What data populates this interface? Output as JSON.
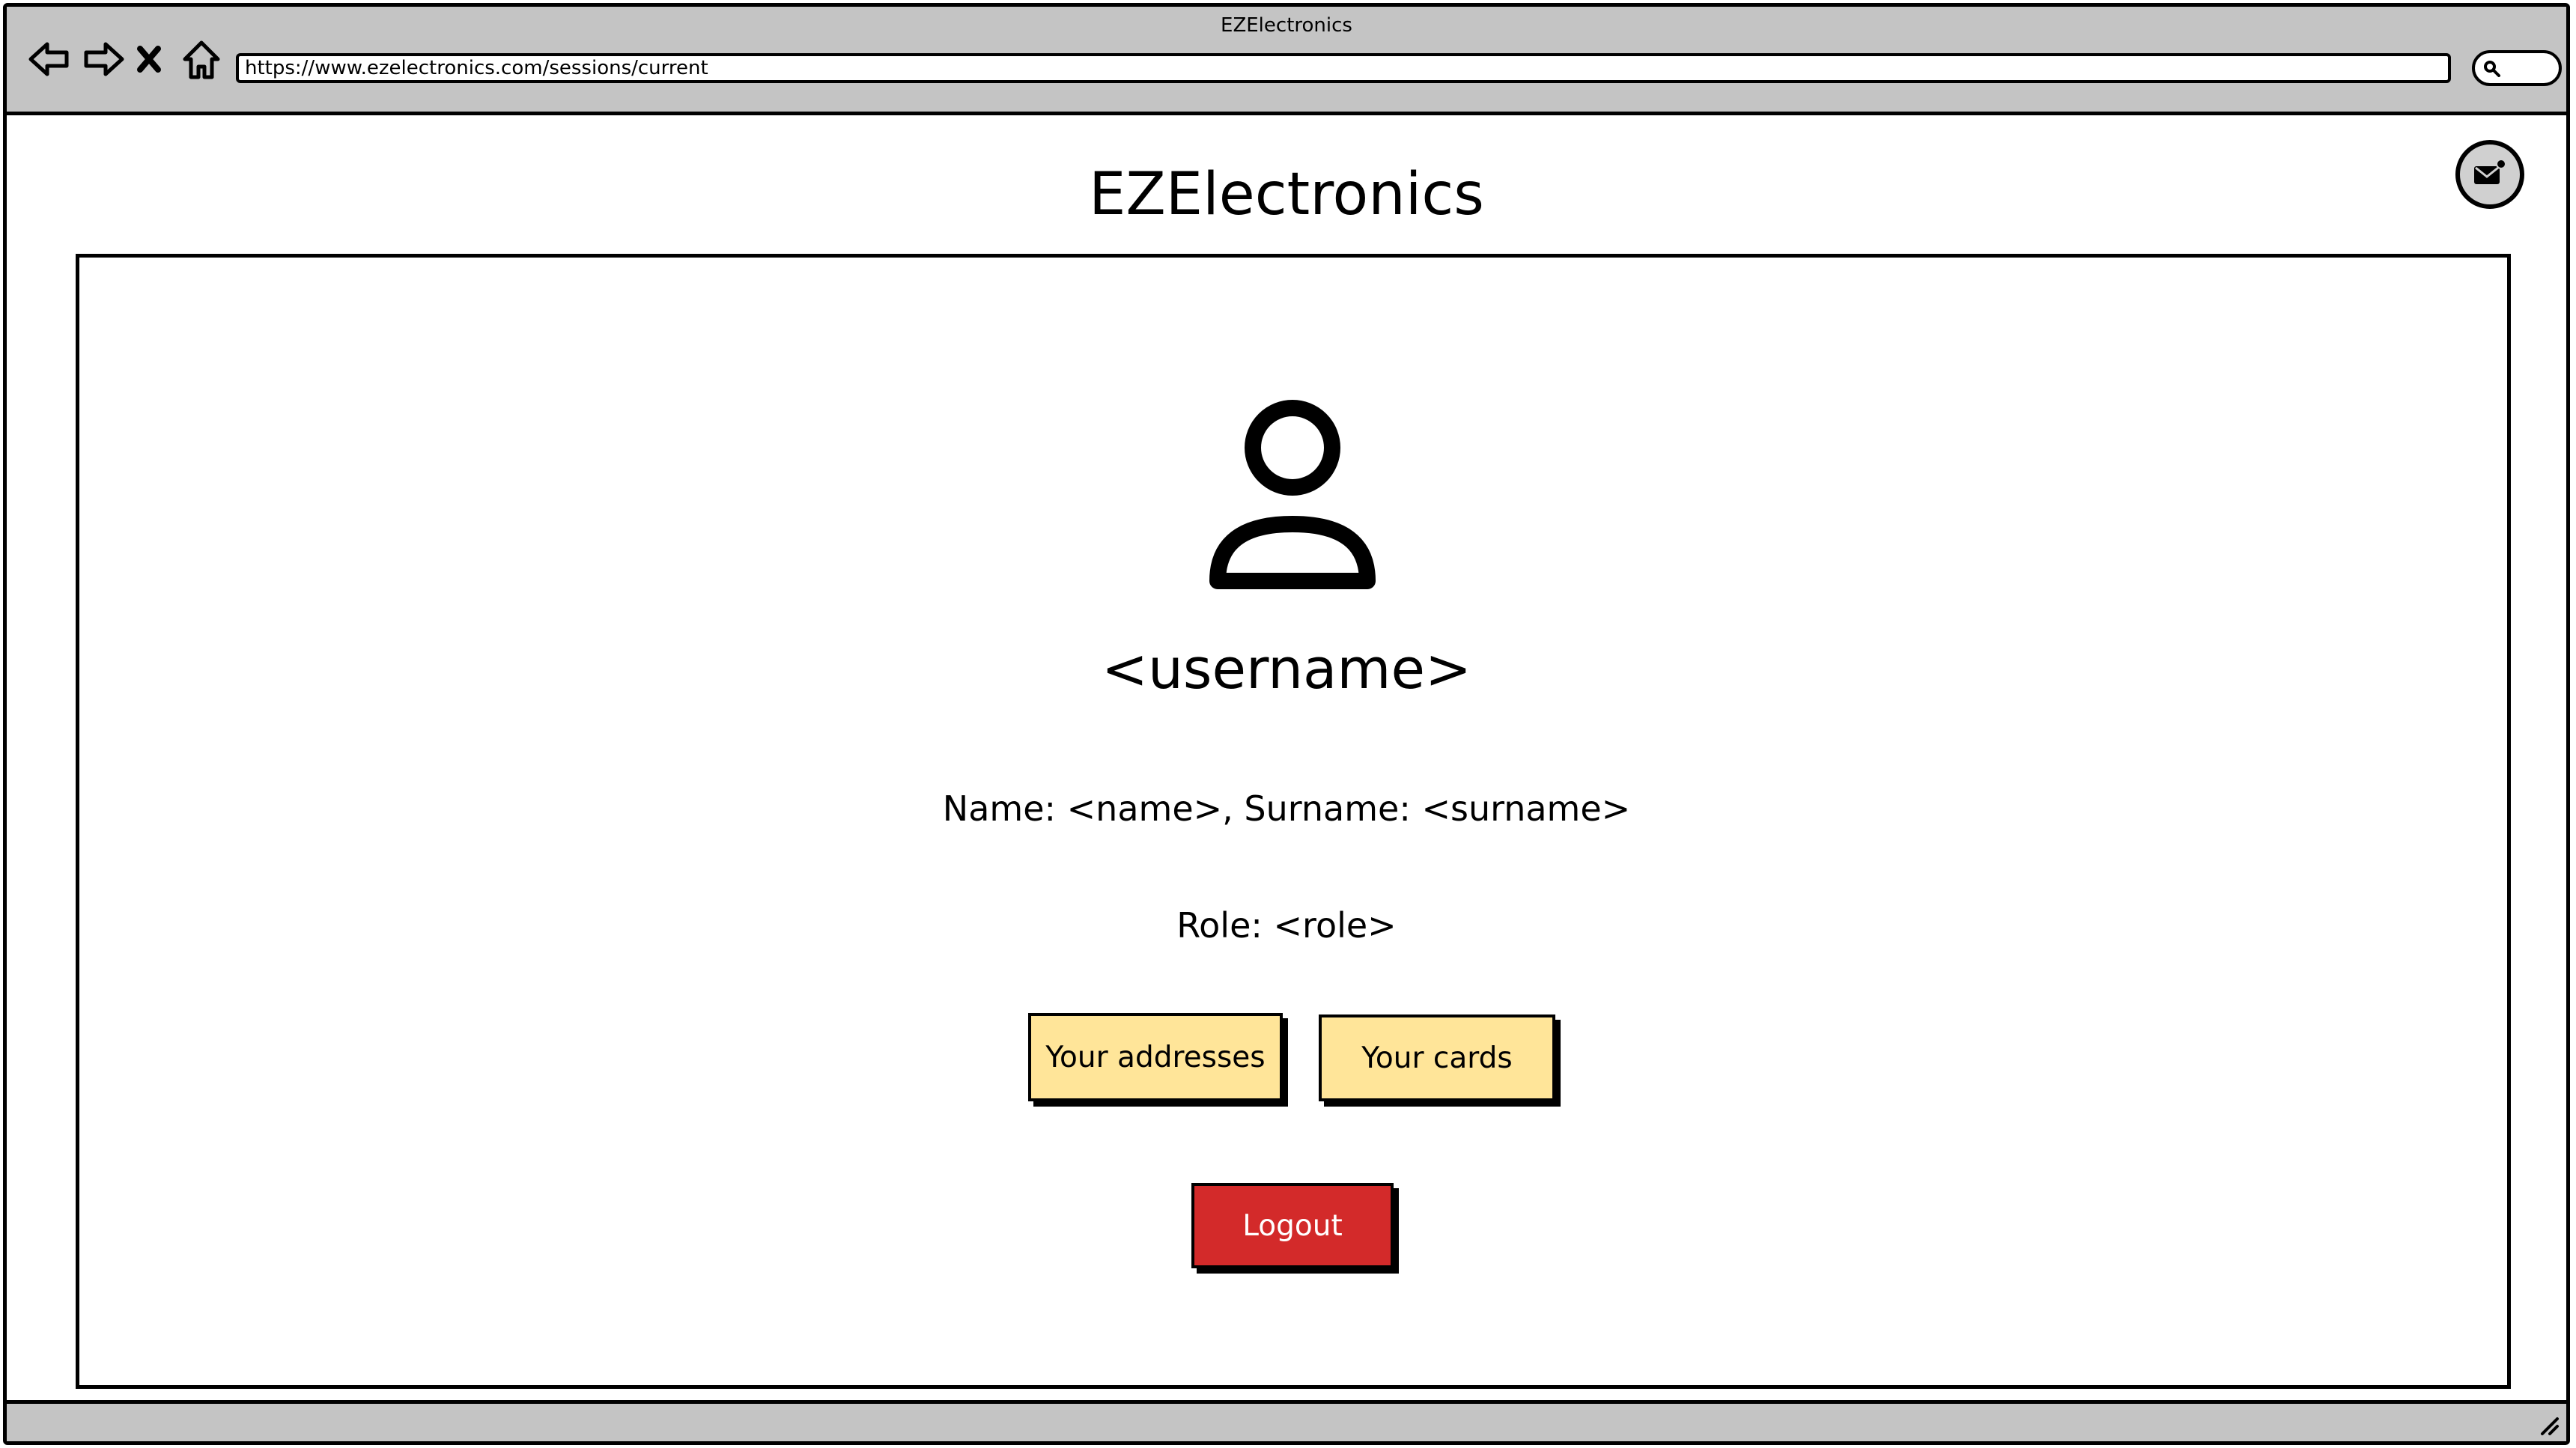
{
  "window": {
    "title": "EZElectronics",
    "url": "https://www.ezelectronics.com/sessions/current"
  },
  "toolbar": {
    "icons": [
      "back-arrow-icon",
      "forward-arrow-icon",
      "close-x-icon",
      "home-icon",
      "search-icon"
    ]
  },
  "header": {
    "app_title": "EZElectronics",
    "mail_icon": "mail-notification-icon"
  },
  "profile": {
    "avatar_icon": "user-icon",
    "username": "<username>",
    "name_line": "Name: <name>, Surname: <surname>",
    "role_line": "Role: <role>"
  },
  "actions": {
    "addresses_label": "Your addresses",
    "cards_label": "Your cards",
    "logout_label": "Logout"
  },
  "colors": {
    "chrome_gray": "#c4c4c4",
    "button_yellow": "#ffe599",
    "logout_red": "#d32a2a"
  }
}
